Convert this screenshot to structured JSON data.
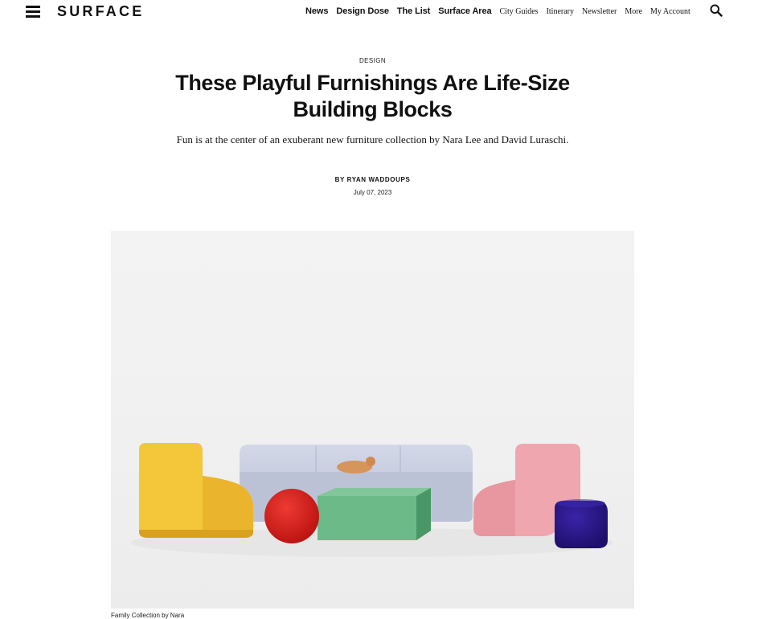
{
  "header": {
    "logo": "SURFACE",
    "nav_primary": [
      "News",
      "Design Dose",
      "The List",
      "Surface Area"
    ],
    "nav_secondary": [
      "City Guides",
      "Itinerary",
      "Newsletter",
      "More",
      "My Account"
    ],
    "menu_icon": "hamburger-menu-icon",
    "search_icon": "search-icon"
  },
  "article": {
    "category": "DESIGN",
    "title": "These Playful Furnishings Are Life-Size Building Blocks",
    "dek": "Fun is at the center of an exuberant new furniture collection by Nara Lee and David Luraschi.",
    "byline_prefix": "BY",
    "author": "RYAN WADDOUPS",
    "date": "July 07, 2023",
    "image_caption": "Family Collection by Nara"
  },
  "colors": {
    "yellow_chair": "#f4c63a",
    "red_ball": "#d91c1c",
    "green_block": "#5fae7d",
    "lavender_sofa": "#c6ccdf",
    "pink_chair": "#efa6ae",
    "navy_pouf": "#2a1686",
    "background": "#ffffff",
    "text": "#111111"
  }
}
